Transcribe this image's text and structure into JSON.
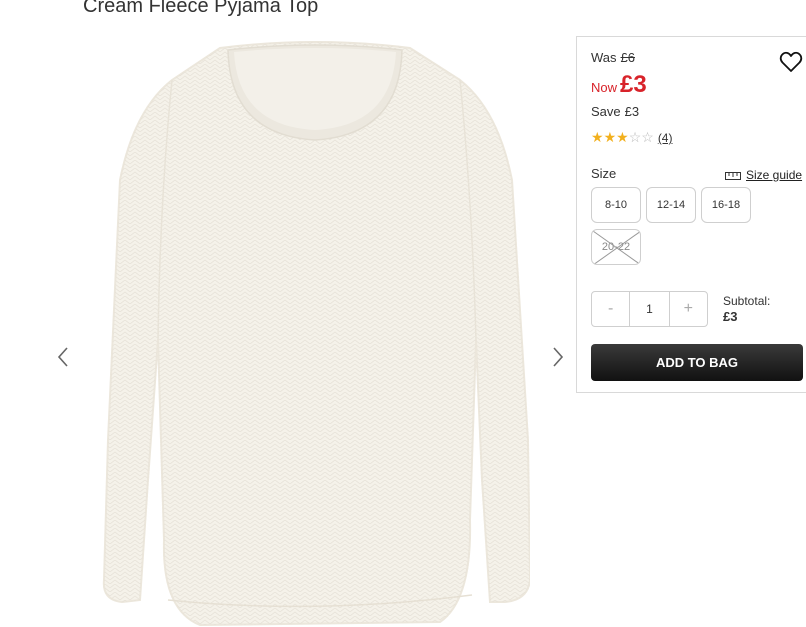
{
  "product": {
    "title": "Cream Fleece Pyjama Top"
  },
  "carousel": {
    "prev_icon": "chevron-left-icon",
    "next_icon": "chevron-right-icon"
  },
  "pricing": {
    "was_label": "Was",
    "was_price": "£6",
    "now_label": "Now",
    "now_price": "£3",
    "save_label": "Save",
    "save_amount": "£3",
    "now_color": "#d8232a"
  },
  "wishlist": {
    "icon": "heart-icon"
  },
  "rating": {
    "stars_filled": 3,
    "stars_total": 5,
    "review_count": "(4)",
    "star_color": "#f2b01e"
  },
  "size": {
    "label": "Size",
    "guide_label": "Size guide",
    "guide_icon": "ruler-icon",
    "options": [
      {
        "label": "8-10",
        "available": true
      },
      {
        "label": "12-14",
        "available": true
      },
      {
        "label": "16-18",
        "available": true
      },
      {
        "label": "20-22",
        "available": false
      }
    ]
  },
  "quantity": {
    "minus": "-",
    "value": "1",
    "plus": "+"
  },
  "subtotal": {
    "label": "Subtotal:",
    "amount": "£3"
  },
  "cart": {
    "add_label": "ADD TO BAG"
  }
}
